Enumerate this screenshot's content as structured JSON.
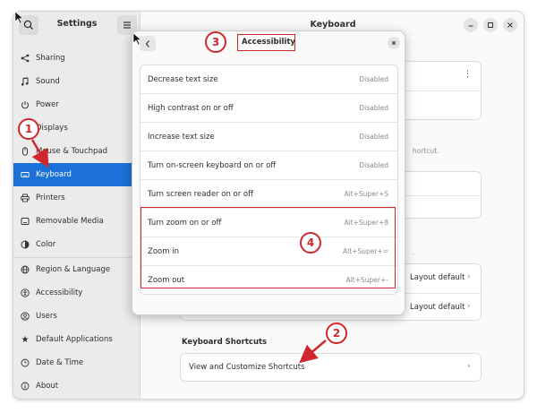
{
  "sidebar": {
    "title": "Settings",
    "items": [
      {
        "label": "Sharing",
        "icon": "share-icon",
        "active": false
      },
      {
        "label": "Sound",
        "icon": "music-note-icon",
        "active": false
      },
      {
        "label": "Power",
        "icon": "power-icon",
        "active": false
      },
      {
        "label": "Displays",
        "icon": "display-icon",
        "active": false
      },
      {
        "label": "Mouse & Touchpad",
        "icon": "mouse-icon",
        "active": false
      },
      {
        "label": "Keyboard",
        "icon": "keyboard-icon",
        "active": true
      },
      {
        "label": "Printers",
        "icon": "printer-icon",
        "active": false
      },
      {
        "label": "Removable Media",
        "icon": "media-icon",
        "active": false
      },
      {
        "label": "Color",
        "icon": "color-icon",
        "active": false
      },
      {
        "label": "Region & Language",
        "icon": "globe-icon",
        "active": false
      },
      {
        "label": "Accessibility",
        "icon": "accessibility-icon",
        "active": false
      },
      {
        "label": "Users",
        "icon": "users-icon",
        "active": false
      },
      {
        "label": "Default Applications",
        "icon": "star-icon",
        "active": false
      },
      {
        "label": "Date & Time",
        "icon": "clock-icon",
        "active": false
      },
      {
        "label": "About",
        "icon": "info-icon",
        "active": false
      }
    ]
  },
  "main": {
    "title": "Keyboard",
    "hint_fragment": "hortcut.",
    "layout_rows": [
      "Layout default",
      "Layout default"
    ],
    "shortcuts_section_title": "Keyboard Shortcuts",
    "shortcuts_row_label": "View and Customize Shortcuts"
  },
  "dialog": {
    "title": "Accessibility",
    "rows": [
      {
        "label": "Decrease text size",
        "value": "Disabled"
      },
      {
        "label": "High contrast on or off",
        "value": "Disabled"
      },
      {
        "label": "Increase text size",
        "value": "Disabled"
      },
      {
        "label": "Turn on-screen keyboard on or off",
        "value": "Disabled"
      },
      {
        "label": "Turn screen reader on or off",
        "value": "Alt+Super+S"
      },
      {
        "label": "Turn zoom on or off",
        "value": "Alt+Super+8"
      },
      {
        "label": "Zoom in",
        "value": "Alt+Super+="
      },
      {
        "label": "Zoom out",
        "value": "Alt+Super+-"
      }
    ]
  },
  "annotations": {
    "badges": [
      "1",
      "2",
      "3",
      "4"
    ],
    "color": "#d0272e"
  },
  "colors": {
    "accent": "#1c71d8",
    "sidebar_bg": "#ebebeb"
  }
}
